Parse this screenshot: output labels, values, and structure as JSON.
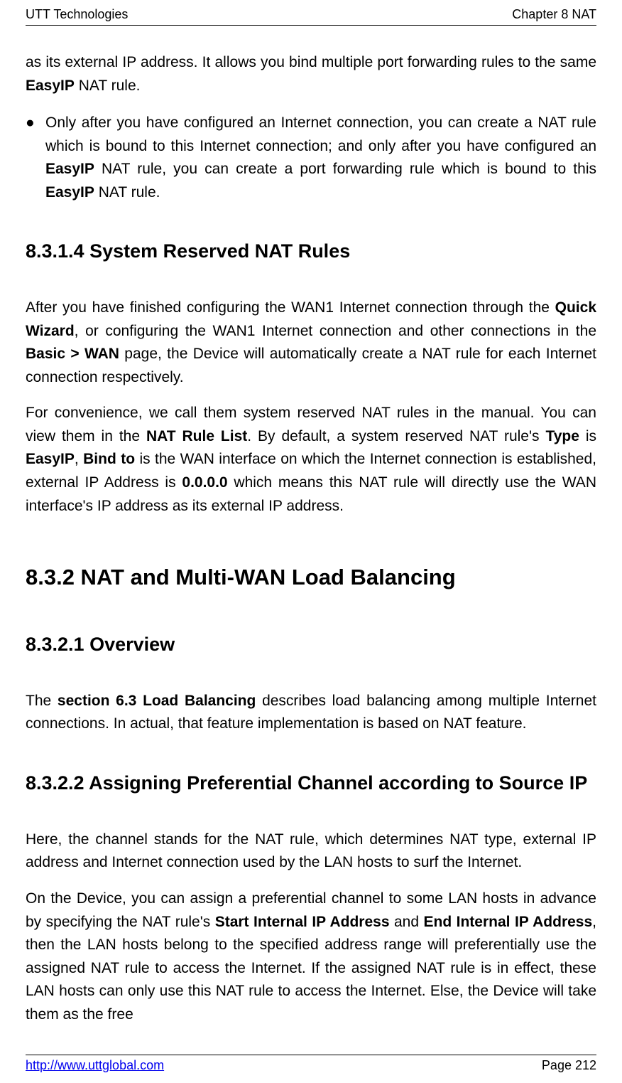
{
  "header": {
    "left": "UTT Technologies",
    "right": "Chapter 8 NAT"
  },
  "para_intro_1": "as its external IP address. It allows you bind multiple port forwarding rules to the same ",
  "para_intro_bold1": "EasyIP",
  "para_intro_2": " NAT rule.",
  "bullet1_1": "Only after you have configured an Internet connection, you can create a NAT rule which is bound to this Internet connection; and only after you have configured an ",
  "bullet1_b1": "EasyIP",
  "bullet1_2": " NAT rule, you can create a port forwarding rule which is bound to this ",
  "bullet1_b2": "EasyIP",
  "bullet1_3": " NAT rule.",
  "h_8314": "8.3.1.4  System Reserved NAT Rules",
  "p8314a_1": "After you have finished configuring the WAN1 Internet connection through the ",
  "p8314a_b1": "Quick Wizard",
  "p8314a_2": ", or configuring the WAN1 Internet connection and other connections in the ",
  "p8314a_b2": "Basic > WAN",
  "p8314a_3": " page, the Device will automatically create a NAT rule for each Internet connection respectively.",
  "p8314b_1": "For convenience, we call them system reserved NAT rules in the manual. You can view them in the ",
  "p8314b_b1": "NAT Rule List",
  "p8314b_2": ". By default, a system reserved NAT rule's ",
  "p8314b_b2": "Type",
  "p8314b_3": " is ",
  "p8314b_b3": "EasyIP",
  "p8314b_4": ", ",
  "p8314b_b4": "Bind to",
  "p8314b_5": " is the WAN interface on which the Internet connection is established, external IP Address is ",
  "p8314b_b5": "0.0.0.0",
  "p8314b_6": " which means this NAT rule will directly use the WAN interface's IP address as its external IP address.",
  "h_832": "8.3.2    NAT and Multi-WAN Load Balancing",
  "h_8321": "8.3.2.1  Overview",
  "p8321_1": "The ",
  "p8321_b1": "section 6.3 Load Balancing",
  "p8321_2": " describes load balancing among multiple Internet connections. In actual, that feature implementation is based on NAT feature.",
  "h_8322": "8.3.2.2  Assigning Preferential Channel according to Source IP",
  "p8322a": "Here, the channel stands for the NAT rule, which determines NAT type, external IP address and Internet connection used by the LAN hosts to surf the Internet.",
  "p8322b_1": "On the Device, you can assign a preferential channel to some LAN hosts in advance by specifying the NAT rule's ",
  "p8322b_b1": "Start Internal IP Address",
  "p8322b_2": " and ",
  "p8322b_b2": "End Internal IP Address",
  "p8322b_3": ", then the LAN hosts belong to the specified address range will preferentially use the assigned NAT rule to access the Internet. If the assigned NAT rule is in effect, these LAN hosts can only use this NAT rule to access the Internet. Else, the Device will take them as the free",
  "footer": {
    "url": "http://www.uttglobal.com",
    "page": "Page 212"
  }
}
